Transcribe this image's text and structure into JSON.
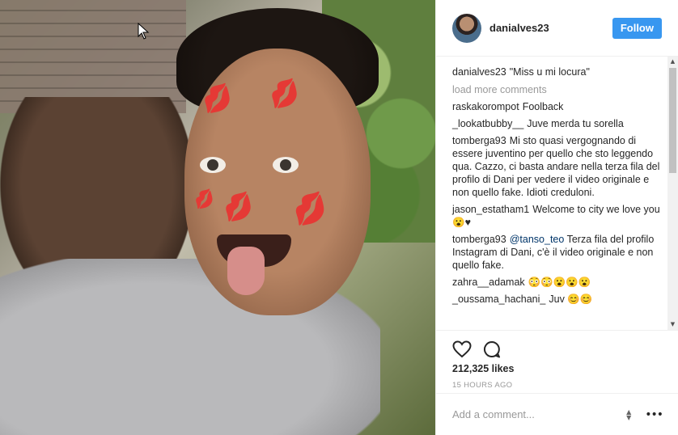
{
  "post": {
    "username": "danialves23",
    "follow_label": "Follow",
    "caption": {
      "user": "danialves23",
      "text": "\"Miss u mi locura\""
    },
    "load_more_label": "load more comments",
    "comments": [
      {
        "user": "raskakorompot",
        "text": "Foolback",
        "mention": ""
      },
      {
        "user": "_lookatbubby__",
        "text": "Juve merda tu sorella",
        "mention": ""
      },
      {
        "user": "tomberga93",
        "text": "Mi sto quasi vergognando di essere juventino per quello che sto leggendo qua. Cazzo, ci basta andare nella terza fila del profilo di Dani per vedere il video originale e non quello fake. Idioti creduloni.",
        "mention": ""
      },
      {
        "user": "jason_estatham1",
        "text": "Welcome to city we love you😮♥",
        "mention": ""
      },
      {
        "user": "tomberga93",
        "text": "Terza fila del profilo Instagram di Dani, c'è il video originale e non quello fake.",
        "mention": "@tanso_teo"
      },
      {
        "user": "zahra__adamak",
        "text": "😳😳😮😮😮",
        "mention": ""
      },
      {
        "user": "_oussama_hachani_",
        "text": "Juv 😊😊",
        "mention": ""
      }
    ],
    "likes": "212,325 likes",
    "timestamp": "15 HOURS AGO",
    "add_comment_placeholder": "Add a comment...",
    "more_label": "•••"
  },
  "icons": {
    "like": "heart-outline-icon",
    "comment": "speech-bubble-icon",
    "more": "more-options-icon"
  },
  "colors": {
    "follow_button": "#3897f0",
    "muted_text": "#999999",
    "mention": "#003569",
    "kiss_marks": "#d3151a"
  }
}
